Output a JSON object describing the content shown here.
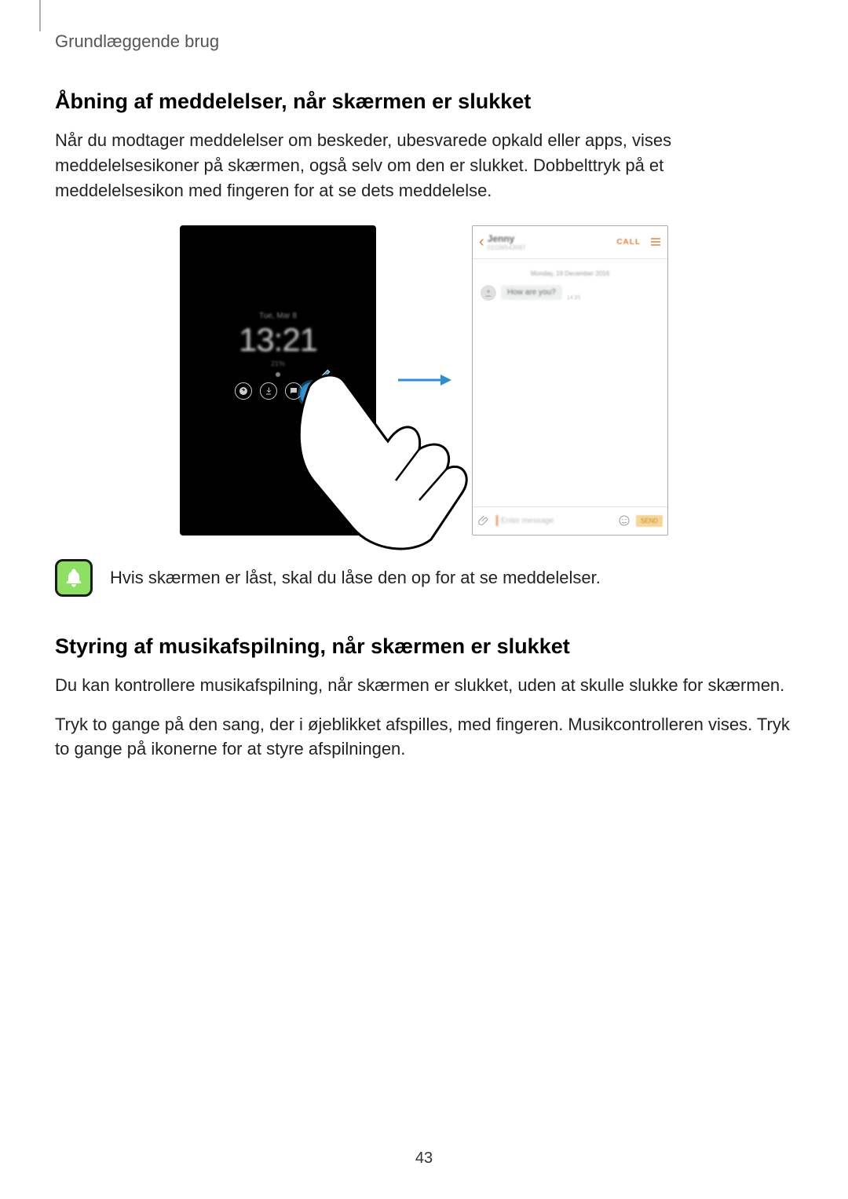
{
  "breadcrumb": "Grundlæggende brug",
  "section1": {
    "heading": "Åbning af meddelelser, når skærmen er slukket",
    "body": "Når du modtager meddelelser om beskeder, ubesvarede opkald eller apps, vises meddelelsesikoner på skærmen, også selv om den er slukket. Dobbelttryk på et meddelelsesikon med fingeren for at se dets meddelelse."
  },
  "aod": {
    "date": "Tue, Mar 8",
    "time": "13:21",
    "sub": "21%"
  },
  "chat": {
    "name": "Jenny",
    "number": "01036543087",
    "call": "CALL",
    "date": "Monday, 19 December 2016",
    "message": "How are you?",
    "time": "14:35",
    "placeholder": "Enter message",
    "send": "SEND"
  },
  "note": "Hvis skærmen er låst, skal du låse den op for at se meddelelser.",
  "section2": {
    "heading": "Styring af musikafspilning, når skærmen er slukket",
    "body1": "Du kan kontrollere musikafspilning, når skærmen er slukket, uden at skulle slukke for skærmen.",
    "body2": "Tryk to gange på den sang, der i øjeblikket afspilles, med fingeren. Musikcontrolleren vises. Tryk to gange på ikonerne for at styre afspilningen."
  },
  "pageNumber": "43"
}
